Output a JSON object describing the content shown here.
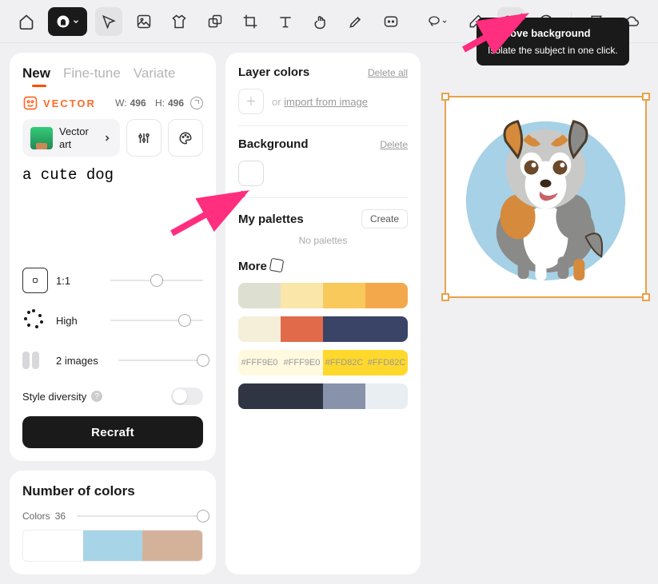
{
  "toolbar": {
    "tooltip_title": "Remove background",
    "tooltip_sub": "Isolate the subject in one click."
  },
  "tabs": {
    "new": "New",
    "finetune": "Fine-tune",
    "variate": "Variate"
  },
  "vector": {
    "label": "VECTOR",
    "w_label": "W:",
    "w_val": "496",
    "h_label": "H:",
    "h_val": "496",
    "style_name": "Vector art"
  },
  "prompt": "a cute dog",
  "sliders": {
    "ratio": "1:1",
    "quality": "High",
    "images": "2 images",
    "diversity_label": "Style diversity"
  },
  "recraft": "Recraft",
  "colors": {
    "layer_title": "Layer colors",
    "delete_all": "Delete all",
    "or": "or ",
    "import": "import from image",
    "bg_title": "Background",
    "delete": "Delete",
    "mypalettes": "My palettes",
    "create": "Create",
    "none": "No palettes",
    "more": "More",
    "hex1": "#FFF9E0",
    "hex2": "#FFD82C"
  },
  "numcolors": {
    "title": "Number of colors",
    "label": "Colors",
    "value": "36"
  },
  "palette_rows": [
    [
      "#dde0d0",
      "#fbe6a9",
      "#f9c95c",
      "#f4a84c"
    ],
    [
      "#f5efd9",
      "#e06a4a",
      "#3a4466",
      "#3a4466"
    ],
    [
      "#fff9e0",
      "#fff9e0",
      "#ffd82c",
      "#ffd82c"
    ],
    [
      "#2f3542",
      "#2f3542",
      "#8892aa",
      "#e9eef2"
    ]
  ],
  "bottom_palette": [
    "#ffffff",
    "#a8d4e8",
    "#d4b29a"
  ]
}
